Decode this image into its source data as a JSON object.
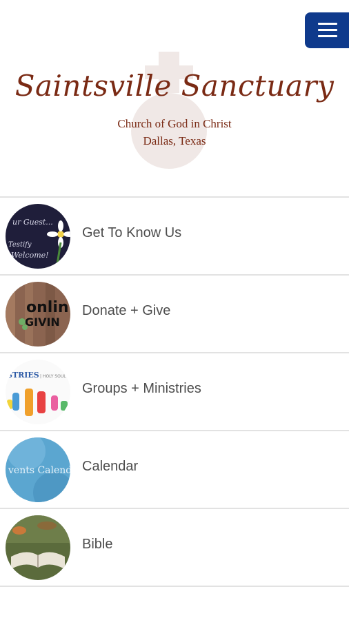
{
  "header": {
    "title": "Saintsville Sanctuary",
    "subtitle_line1": "Church of God in Christ",
    "subtitle_line2": "Dallas, Texas"
  },
  "menu": {
    "icon": "hamburger-menu-icon",
    "color": "#0f3a8c"
  },
  "nav": {
    "items": [
      {
        "label": "Get To Know Us"
      },
      {
        "label": "Donate + Give"
      },
      {
        "label": "Groups + Ministries"
      },
      {
        "label": "Calendar"
      },
      {
        "label": "Bible"
      }
    ]
  },
  "colors": {
    "title": "#7a2a14",
    "divider": "#e2e2e2",
    "label": "#4d4d4d"
  }
}
